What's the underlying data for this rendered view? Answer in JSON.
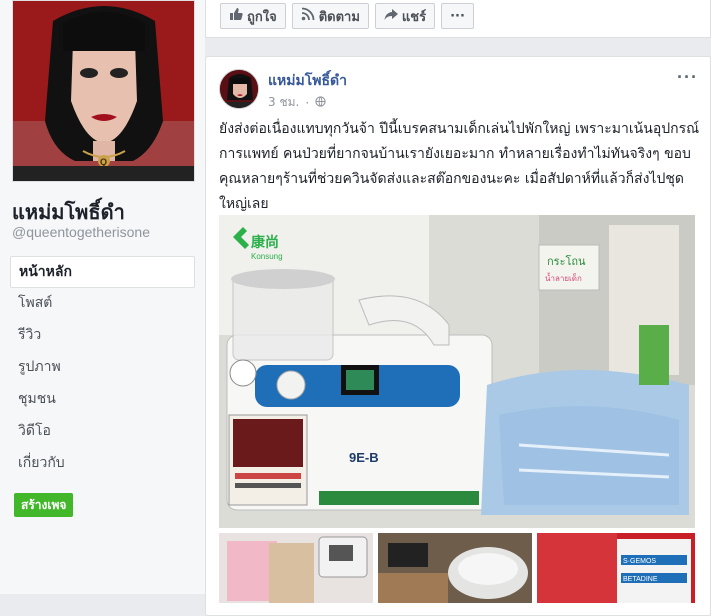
{
  "page": {
    "name": "แหม่มโพธิ์ดำ",
    "handle": "@queentogetherisone"
  },
  "nav": [
    {
      "label": "หน้าหลัก",
      "active": true
    },
    {
      "label": "โพสต์",
      "active": false
    },
    {
      "label": "รีวิว",
      "active": false
    },
    {
      "label": "รูปภาพ",
      "active": false
    },
    {
      "label": "ชุมชน",
      "active": false
    },
    {
      "label": "วิดีโอ",
      "active": false
    },
    {
      "label": "เกี่ยวกับ",
      "active": false
    }
  ],
  "create_page_label": "สร้างเพจ",
  "actions": {
    "like": "ถูกใจ",
    "follow": "ติดตาม",
    "share": "แชร์",
    "more": "···"
  },
  "post": {
    "author": "แหม่มโพธิ์ดำ",
    "time": "3 ชม.",
    "privacy_separator": "·",
    "privacy_icon": "globe-icon",
    "more": "···",
    "text": "ยังส่งต่อเนื่องแทบทุกวันจ้า ปีนี้เบรคสนามเด็กเล่นไปพักใหญ่ เพราะมาเน้นอุปกรณ์การแพทย์ คนป่วยที่ยากจนบ้านเรายังเยอะมาก ทำหลายเรื่องทำไม่ทันจริงๆ ขอบคุณหลายๆร้านที่ช่วยควินจัดส่งและสต๊อกของนะคะ เมื่อสัปดาห์ที่แล้วก็ส่งไปชุดใหญ่เลย",
    "photo_labels": {
      "brand_chinese": "康尚",
      "brand_latin": "Konsung",
      "model": "9E-B",
      "sign": "กระโถน",
      "sign_sub": "น้ำลายเด็ก",
      "box_label_1": "BETADINE",
      "box_label_2": "S·GEMOS"
    }
  },
  "colors": {
    "link": "#365899",
    "green": "#42b72a",
    "bg": "#e9ebee"
  }
}
